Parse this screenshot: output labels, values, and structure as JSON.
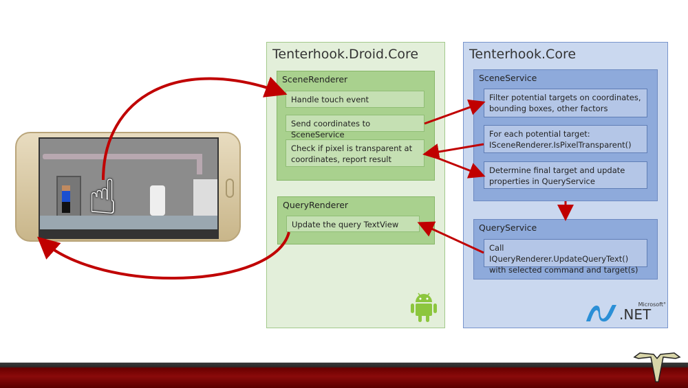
{
  "droid": {
    "title": "Tenterhook.Droid.Core",
    "scene_renderer": {
      "title": "SceneRenderer",
      "items": [
        "Handle touch event",
        "Send coordinates to SceneService",
        "Check if pixel is transparent at coordinates, report result"
      ]
    },
    "query_renderer": {
      "title": "QueryRenderer",
      "items": [
        "Update the query TextView"
      ]
    }
  },
  "core": {
    "title": "Tenterhook.Core",
    "scene_service": {
      "title": "SceneService",
      "items": [
        "Filter potential targets on coordinates, bounding boxes, other factors",
        "For each potential target: ISceneRenderer.IsPixelTransparent()",
        "Determine final target and update properties in QueryService"
      ]
    },
    "query_service": {
      "title": "QueryService",
      "items": [
        "Call IQueryRenderer.UpdateQueryText() with selected command and target(s)"
      ]
    }
  },
  "logos": {
    "dotnet": "Microsoft .NET",
    "android": "android-robot-icon",
    "tenterhook": "tenterhook-logo"
  },
  "colors": {
    "arrow": "#c00000",
    "droid_panel": "#e3efda",
    "core_panel": "#cad8ef",
    "band": "#7a0000"
  }
}
